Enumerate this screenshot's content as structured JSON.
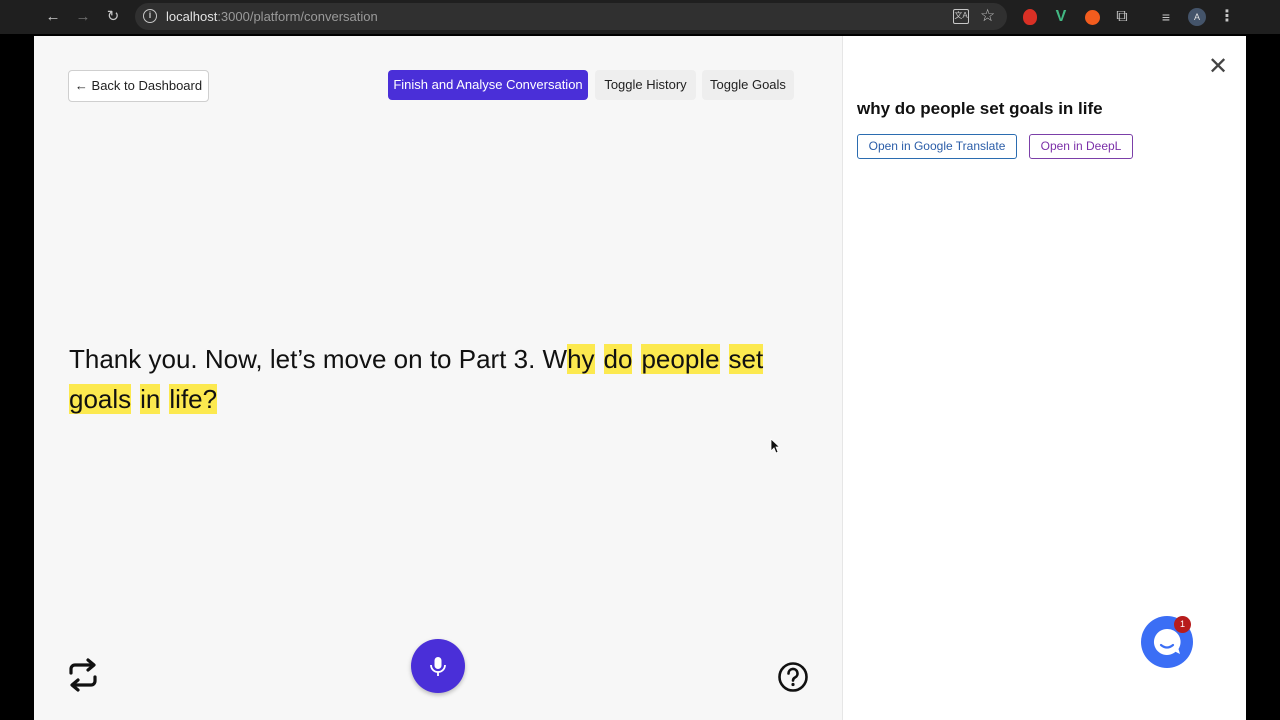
{
  "browser": {
    "url_host": "localhost",
    "url_path": ":3000/platform/conversation",
    "profile_initial": "A"
  },
  "toolbar": {
    "back_label": "← Back to Dashboard",
    "finish_label": "Finish and Analyse Conversation",
    "history_label": "Toggle History",
    "goals_label": "Toggle Goals"
  },
  "transcript": {
    "plain": "Thank you. Now, let’s move on to Part 3. W",
    "highlighted_words": [
      "hy",
      "do",
      "people",
      "set",
      "goals",
      "in",
      "life?"
    ]
  },
  "sidebar": {
    "title": "why do people set goals in life",
    "google_translate_label": "Open in Google Translate",
    "deepl_label": "Open in DeepL"
  },
  "chat_widget": {
    "badge_count": "1"
  },
  "colors": {
    "accent": "#4a2fd8",
    "highlight": "#fce94f",
    "chat": "#3b6ef5"
  }
}
